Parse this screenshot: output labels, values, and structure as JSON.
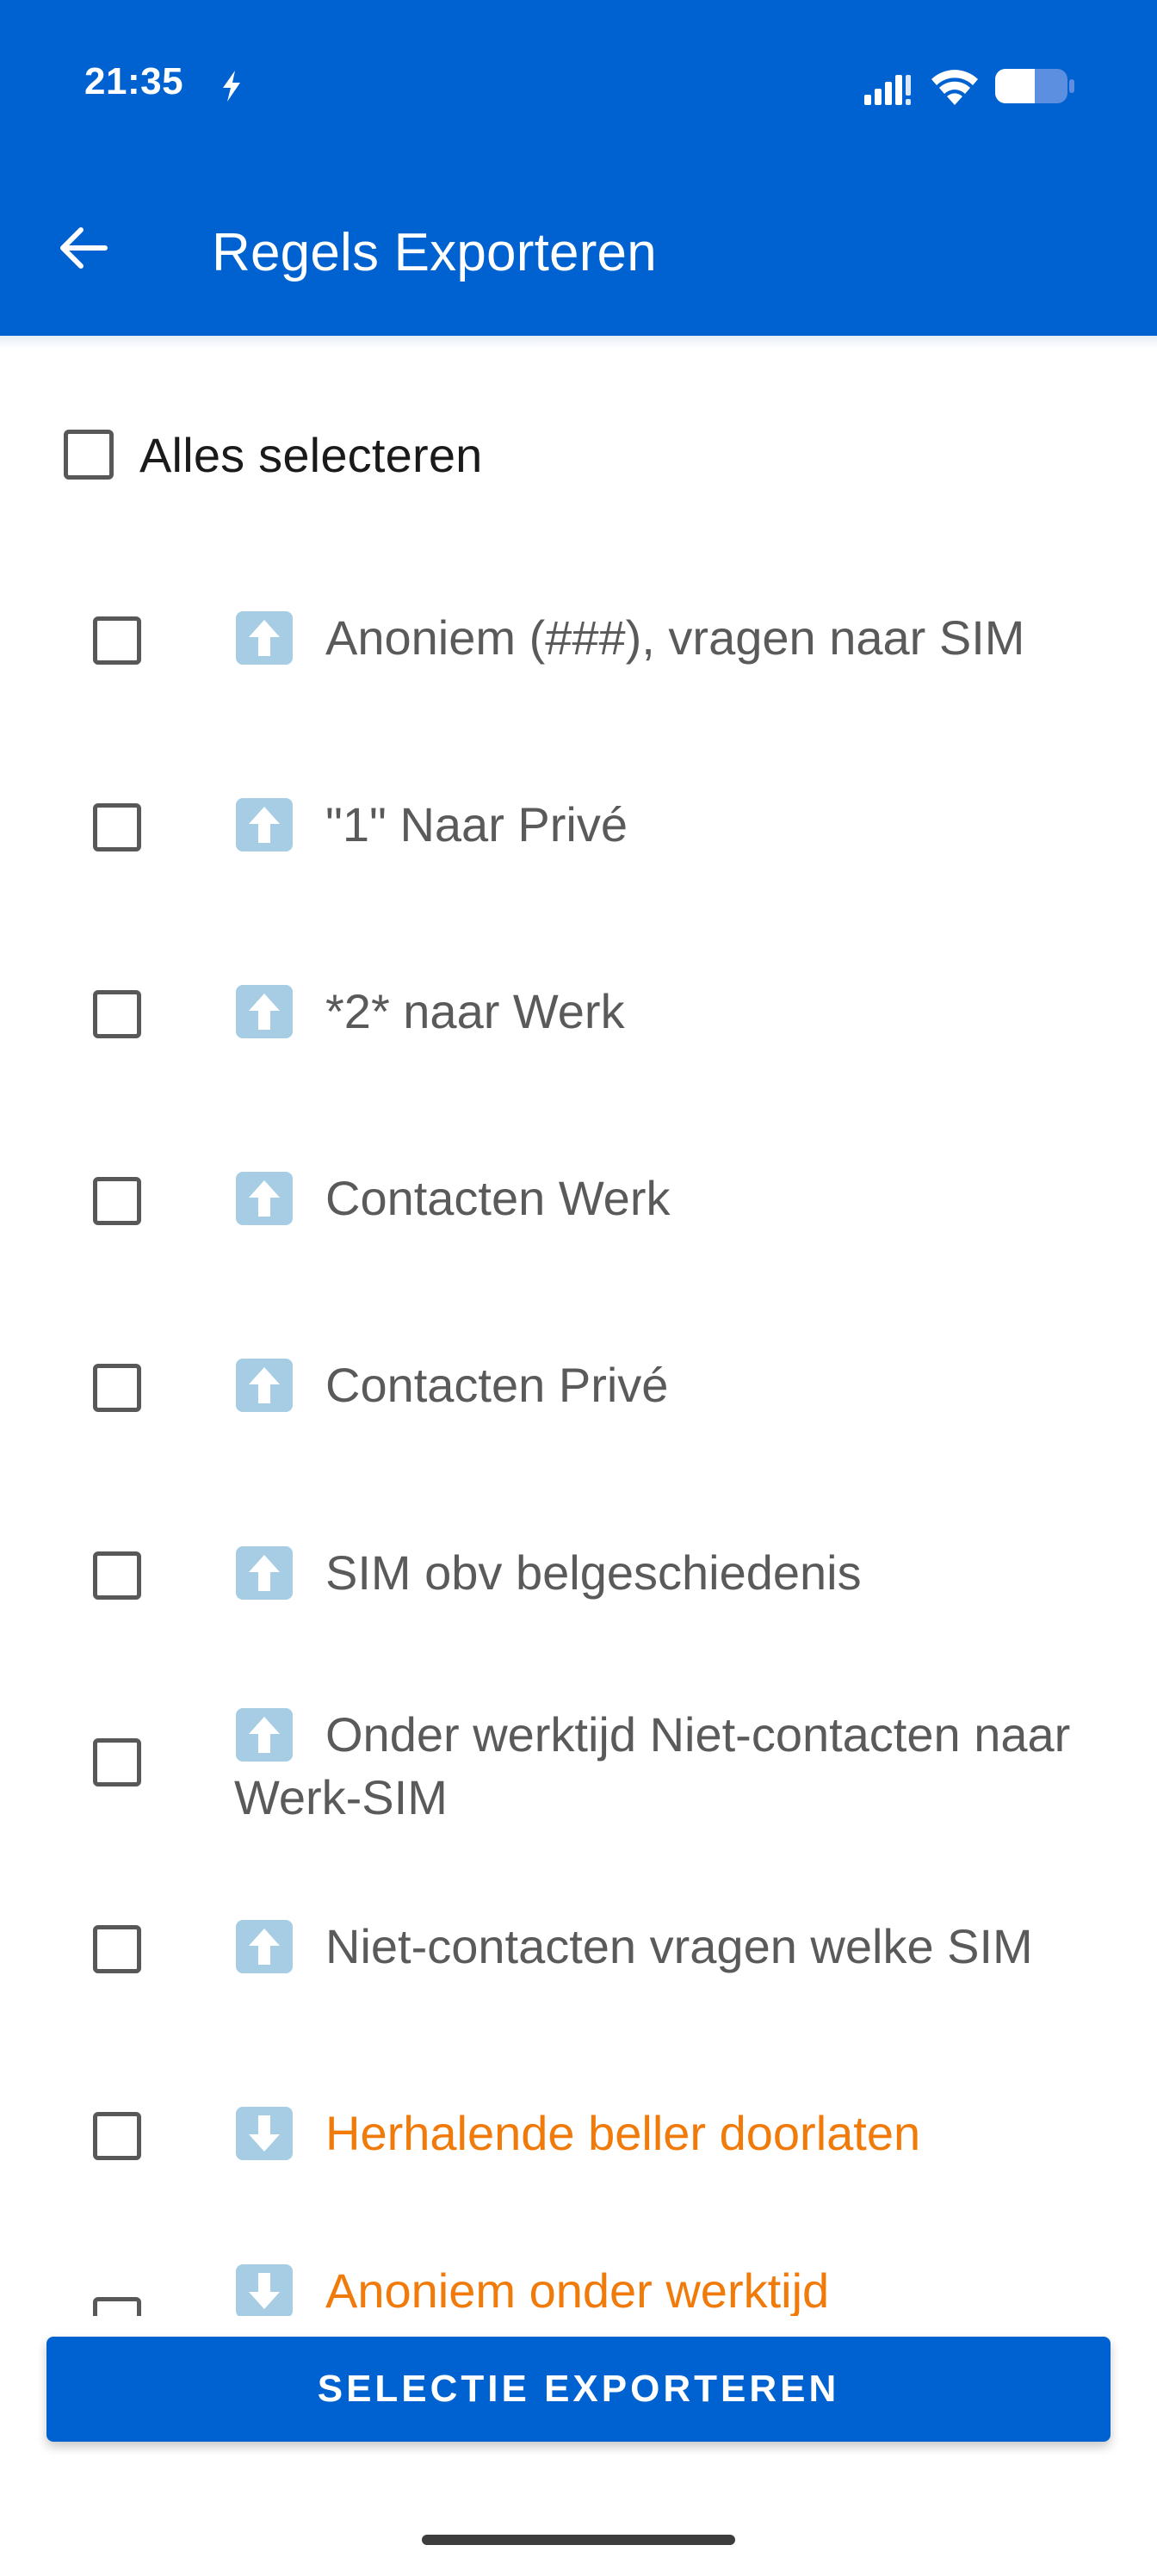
{
  "status_bar": {
    "time": "21:35",
    "icons": [
      "charging-bolt-icon",
      "signal-icon",
      "wifi-icon",
      "battery-icon"
    ]
  },
  "app_bar": {
    "back_icon": "arrow-left-icon",
    "title": "Regels Exporteren"
  },
  "select_all": {
    "label": "Alles selecteren",
    "checked": false
  },
  "rules": [
    {
      "direction": "up",
      "label": "Anoniem (###), vragen naar SIM",
      "color": "gray",
      "checked": false
    },
    {
      "direction": "up",
      "label": "\"1\" Naar Privé",
      "color": "gray",
      "checked": false
    },
    {
      "direction": "up",
      "label": "*2* naar Werk",
      "color": "gray",
      "checked": false
    },
    {
      "direction": "up",
      "label": "Contacten Werk",
      "color": "gray",
      "checked": false
    },
    {
      "direction": "up",
      "label": "Contacten Privé",
      "color": "gray",
      "checked": false
    },
    {
      "direction": "up",
      "label": "SIM obv belgeschiedenis",
      "color": "gray",
      "checked": false
    },
    {
      "direction": "up",
      "label": "Onder werktijd Niet-contacten naar Werk-SIM",
      "color": "gray",
      "checked": false
    },
    {
      "direction": "up",
      "label": "Niet-contacten vragen welke SIM",
      "color": "gray",
      "checked": false
    },
    {
      "direction": "down",
      "label": "Herhalende beller doorlaten",
      "color": "orange",
      "checked": false
    },
    {
      "direction": "down",
      "label": "Anoniem onder werktijd",
      "color": "orange",
      "checked": false
    }
  ],
  "colors": {
    "primary": "#0061D0",
    "text_gray": "#5a5a5a",
    "text_orange": "#F07A0A",
    "icon_bg": "#A6CDE4"
  },
  "export_button": {
    "label": "SELECTIE EXPORTEREN"
  }
}
